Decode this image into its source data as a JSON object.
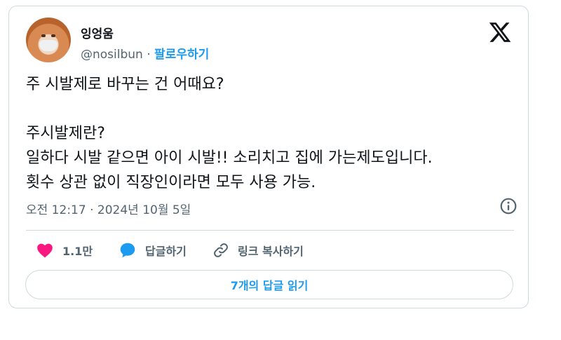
{
  "tweet": {
    "author": {
      "display_name": "잉엉움",
      "handle": "@nosilbun",
      "separator": " · ",
      "follow_label": "팔로우하기"
    },
    "body_lines": [
      "주 시발제로 바꾸는 건 어때요?",
      "",
      "주시발제란?",
      "일하다 시발 같으면 아이 시발!! 소리치고 집에 가는제도입니다.",
      "횟수 상관 없이 직장인이라면 모두 사용 가능."
    ],
    "timestamp": "오전 12:17 · 2024년 10월 5일",
    "actions": {
      "like_count": "1.1만",
      "reply_label": "답글하기",
      "copy_link_label": "링크 복사하기"
    },
    "read_replies_label": "7개의 답글 읽기"
  },
  "icons": {
    "logo": "x-logo-icon",
    "info": "info-icon",
    "like": "heart-icon",
    "reply": "speech-bubble-icon",
    "copy": "link-icon"
  },
  "colors": {
    "accent": "#1d9bf0",
    "like": "#f91880",
    "text": "#0f1419",
    "secondary_text": "#536471",
    "border": "#cfd9de"
  }
}
